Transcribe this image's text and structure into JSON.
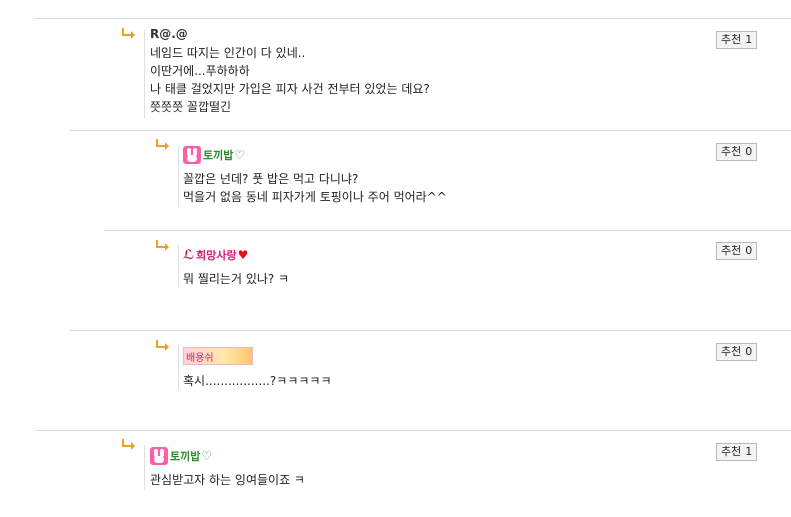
{
  "comments": [
    {
      "author": "R@.@",
      "lines": [
        "네임드 따지는 인간이 다 있네..",
        "이딴거에...푸하하하",
        "나 태클 걸었지만 가입은 피자 사건 전부터 있었는 데요?",
        "쯧쯧쯧 꼴깝떨긴"
      ],
      "recommend_label": "추천",
      "recommend_count": "1"
    },
    {
      "author": "토끼밥",
      "lines": [
        "꼴깝은 넌데? 풋 밥은 먹고 다니냐?",
        "먹을거 없음 동네 피자가게 토핑이나 주어 먹어라^^"
      ],
      "recommend_label": "추천",
      "recommend_count": "0"
    },
    {
      "author": "희망사랑",
      "lines": [
        "뭐 찔리는거 있나? ㅋ"
      ],
      "recommend_label": "추천",
      "recommend_count": "0"
    },
    {
      "author": "배용쉬",
      "lines": [
        "혹시.................?ㅋㅋㅋㅋㅋ"
      ],
      "recommend_label": "추천",
      "recommend_count": "0"
    },
    {
      "author": "토끼밥",
      "lines": [
        "관심받고자 하는 잉여들이죠 ㅋ"
      ],
      "recommend_label": "추천",
      "recommend_count": "1"
    }
  ],
  "colors": {
    "arrow": "#f0a020",
    "divider": "#d9d9d9",
    "recommend_border": "#b9b9b9"
  }
}
